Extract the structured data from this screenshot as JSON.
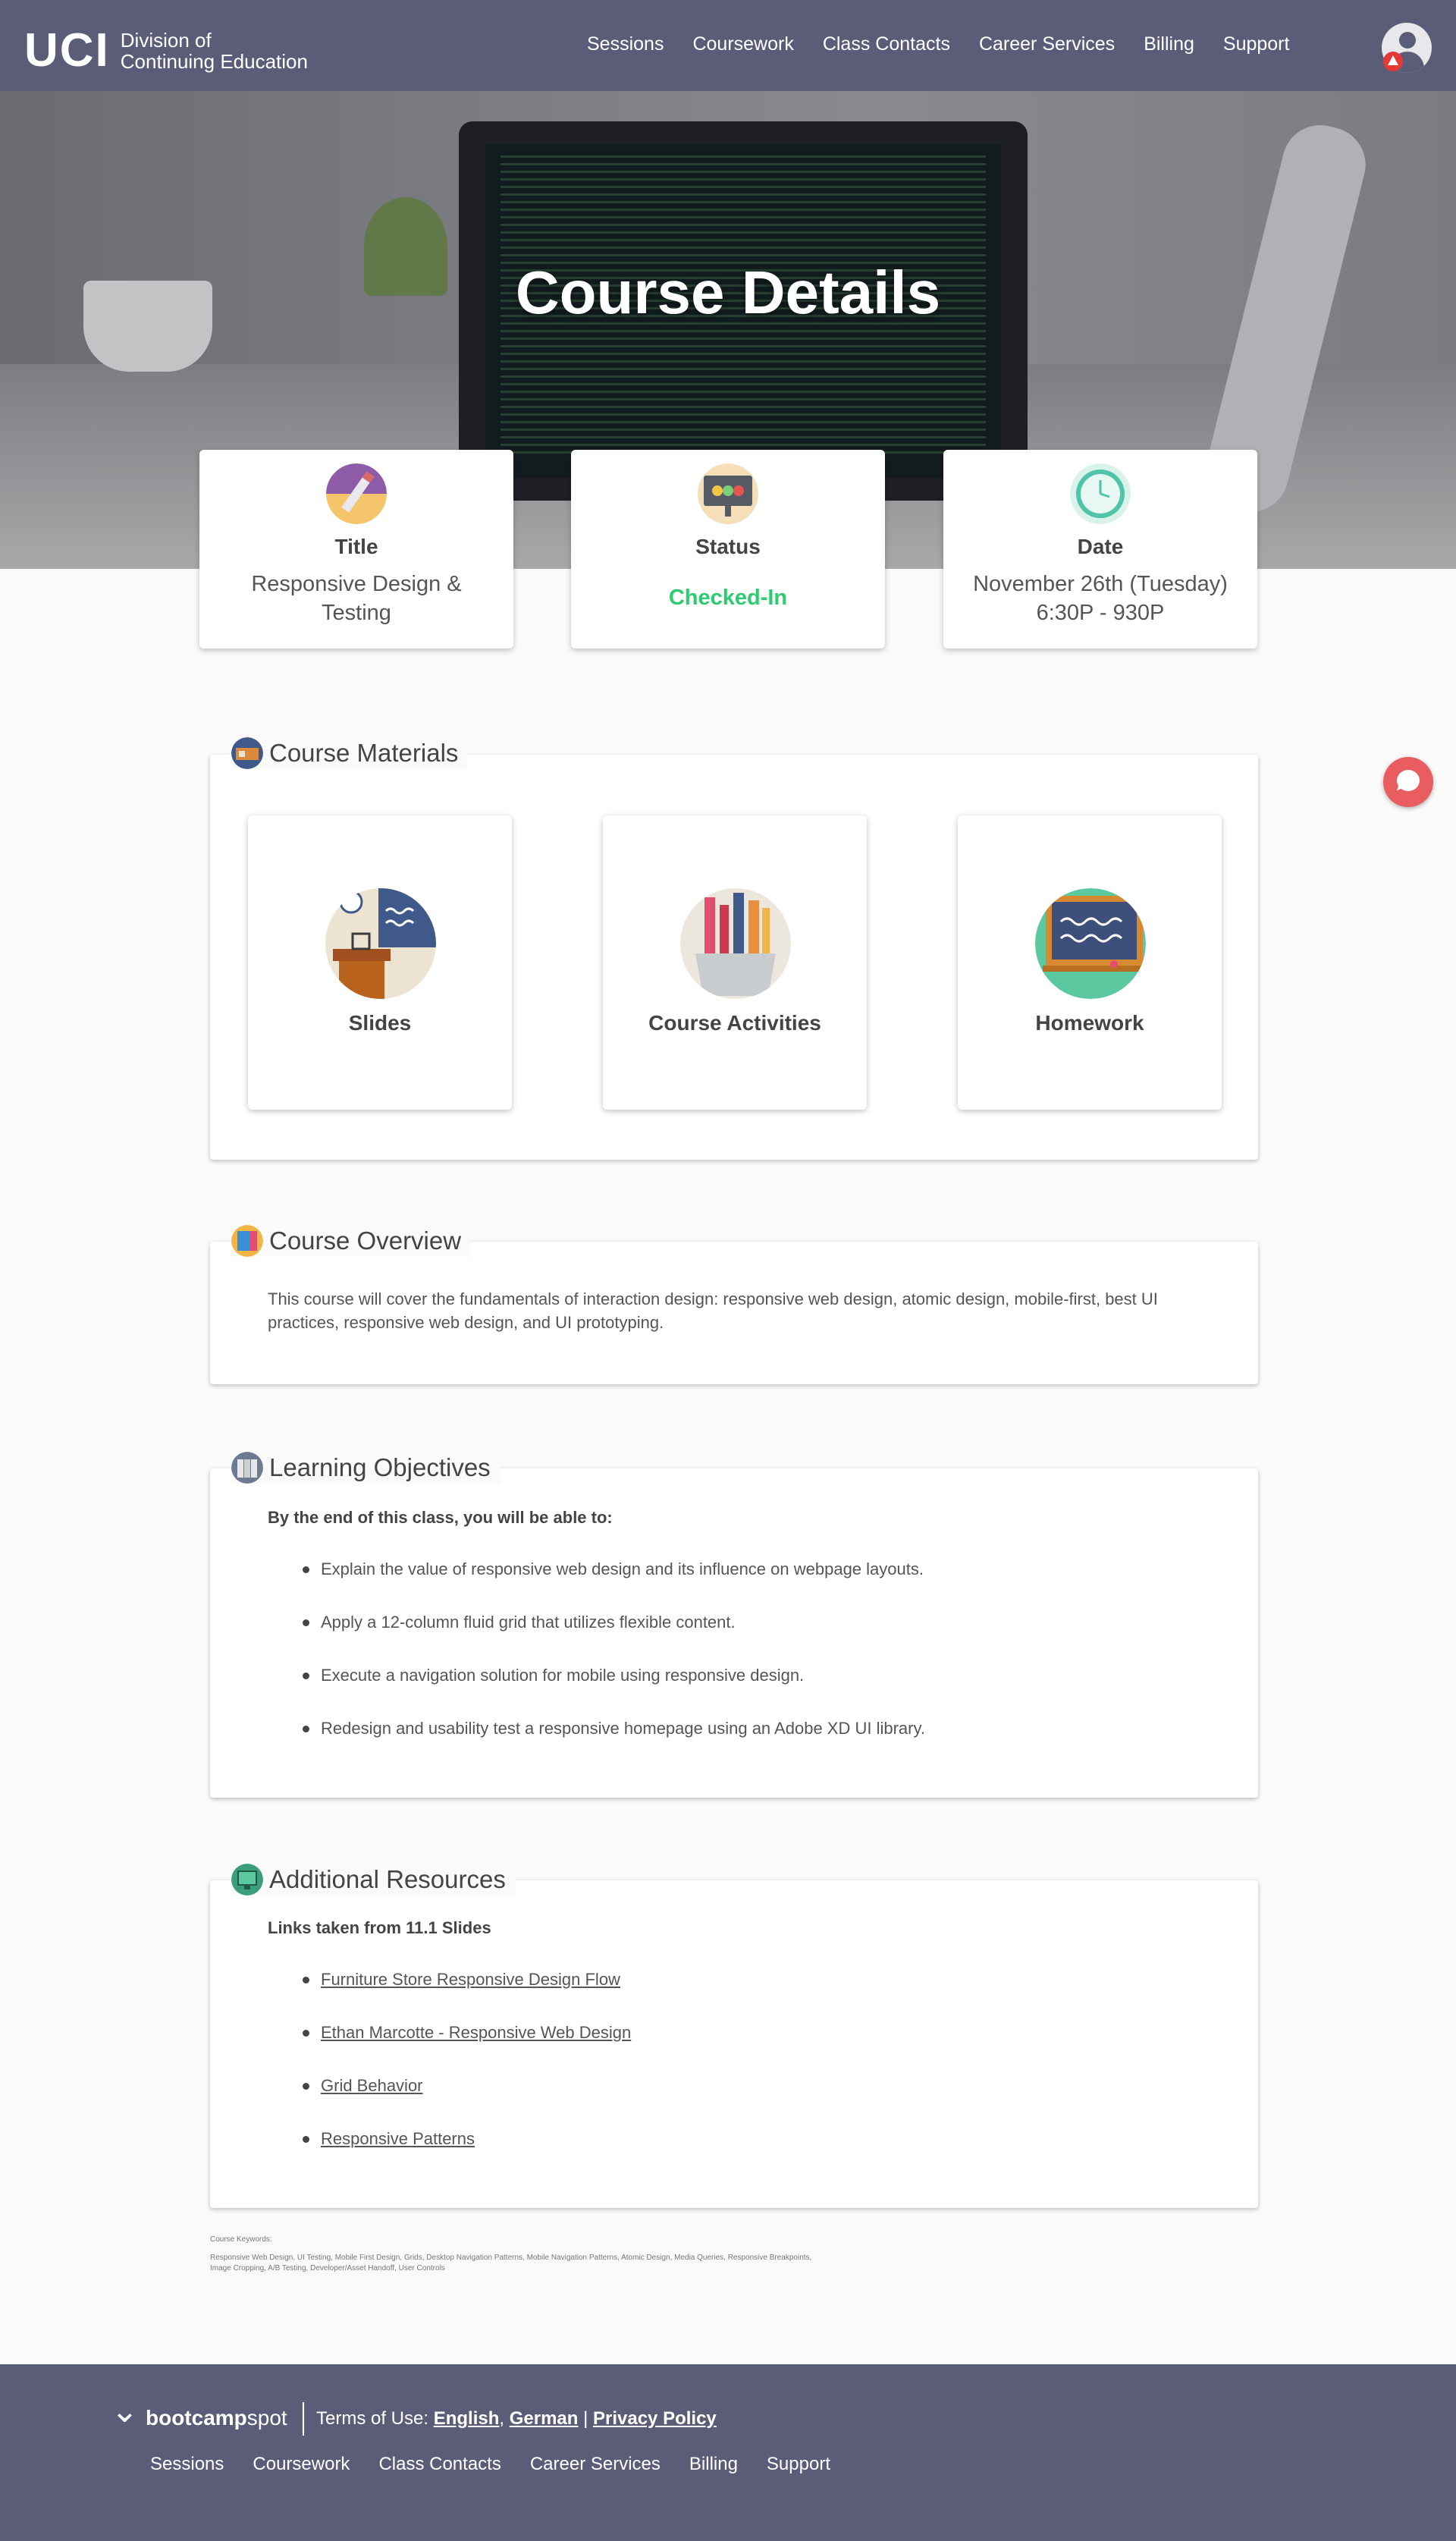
{
  "nav": {
    "logo_mark": "UCI",
    "logo_line1": "Division of",
    "logo_line2": "Continuing Education",
    "links": [
      "Sessions",
      "Coursework",
      "Class Contacts",
      "Career Services",
      "Billing",
      "Support"
    ],
    "avatar_icon": "user-avatar-icon",
    "alert_icon": "alert-badge-icon"
  },
  "hero": {
    "title": "Course Details"
  },
  "info": {
    "title_label": "Title",
    "title_value": "Responsive Design & Testing",
    "status_label": "Status",
    "status_value": "Checked-In",
    "status_color": "#2ecc71",
    "date_label": "Date",
    "date_value": "November 26th (Tuesday) 6:30P - 930P"
  },
  "materials": {
    "heading": "Course Materials",
    "items": [
      "Slides",
      "Course Activities",
      "Homework"
    ]
  },
  "overview": {
    "heading": "Course Overview",
    "text": "This course will cover the fundamentals of interaction design: responsive web design, atomic design, mobile-first, best UI practices, responsive web design, and UI prototyping."
  },
  "objectives": {
    "heading": "Learning Objectives",
    "intro": "By the end of this class, you will be able to:",
    "items": [
      "Explain the value of responsive web design and its influence on webpage layouts.",
      "Apply a 12-column fluid grid that utilizes flexible content.",
      "Execute a navigation solution for mobile using responsive design.",
      "Redesign and usability test a responsive homepage using an Adobe XD UI library."
    ]
  },
  "resources": {
    "heading": "Additional Resources",
    "intro": "Links taken from 11.1 Slides",
    "links": [
      "Furniture Store Responsive Design Flow",
      "Ethan Marcotte - Responsive Web Design",
      "Grid Behavior",
      "Responsive Patterns"
    ]
  },
  "keywords": {
    "label": "Course Keywords:",
    "text": "Responsive Web Design, UI Testing, Mobile First Design, Grids, Desktop Navigation Patterns, Mobile Navigation Patterns, Atomic Design, Media Queries, Responsive Breakpoints, Image Cropping, A/B Testing, Developer/Asset Handoff, User Controls"
  },
  "footer": {
    "brand_bold": "bootcamp",
    "brand_light": "spot",
    "terms_prefix": "Terms of Use:",
    "terms_english": "English",
    "terms_comma": ",",
    "terms_german": "German",
    "terms_pipe": "|",
    "privacy": "Privacy Policy",
    "links": [
      "Sessions",
      "Coursework",
      "Class Contacts",
      "Career Services",
      "Billing",
      "Support"
    ]
  },
  "colors": {
    "nav_bg": "#5b5d78",
    "chat_button": "#e95c5f",
    "status_checked_in": "#2ecc71"
  }
}
